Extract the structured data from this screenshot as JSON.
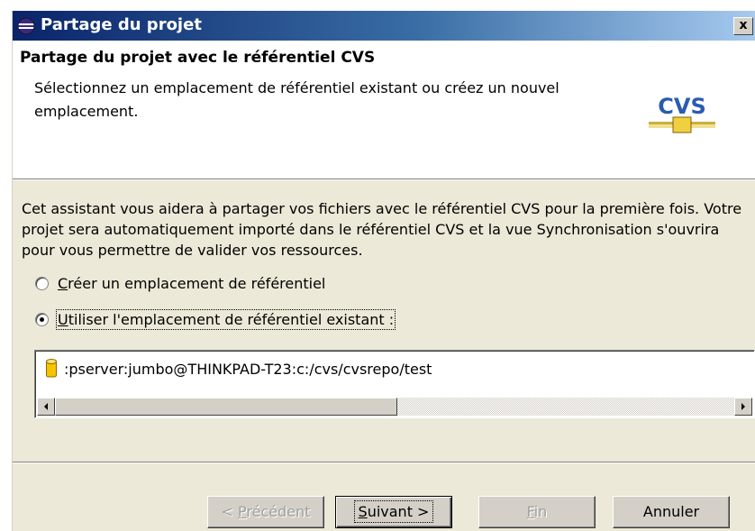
{
  "window": {
    "title": "Partage du projet",
    "close_label": "x"
  },
  "header": {
    "title": "Partage du projet avec le référentiel CVS",
    "description": "Sélectionnez un emplacement de référentiel existant ou créez un nouvel emplacement.",
    "icon_text": "CVS"
  },
  "body": {
    "intro": "Cet assistant vous aidera à partager vos fichiers avec le référentiel CVS pour la première fois. Votre projet sera automatiquement importé dans le référentiel CVS et la vue Synchronisation s'ouvrira pour vous permettre de valider vos ressources.",
    "options": [
      {
        "mnemonic": "C",
        "rest": "réer un emplacement de référentiel",
        "selected": false
      },
      {
        "mnemonic": "U",
        "rest": "tiliser l'emplacement de référentiel existant :",
        "selected": true
      }
    ],
    "repositories": [
      ":pserver:jumbo@THINKPAD-T23:c:/cvs/cvsrepo/test"
    ]
  },
  "buttons": {
    "back_prefix": "< ",
    "back_mnemonic": "P",
    "back_rest": "récédent",
    "next_mnemonic": "S",
    "next_rest": "uivant >",
    "finish_mnemonic": "F",
    "finish_rest": "in",
    "cancel": "Annuler"
  },
  "colors": {
    "titlebar_start": "#0a246a",
    "titlebar_end": "#a6caf0",
    "dialog_bg": "#ece9d8",
    "cvs_icon_blue": "#2a5bb0",
    "db_icon_yellow": "#f5c400"
  }
}
